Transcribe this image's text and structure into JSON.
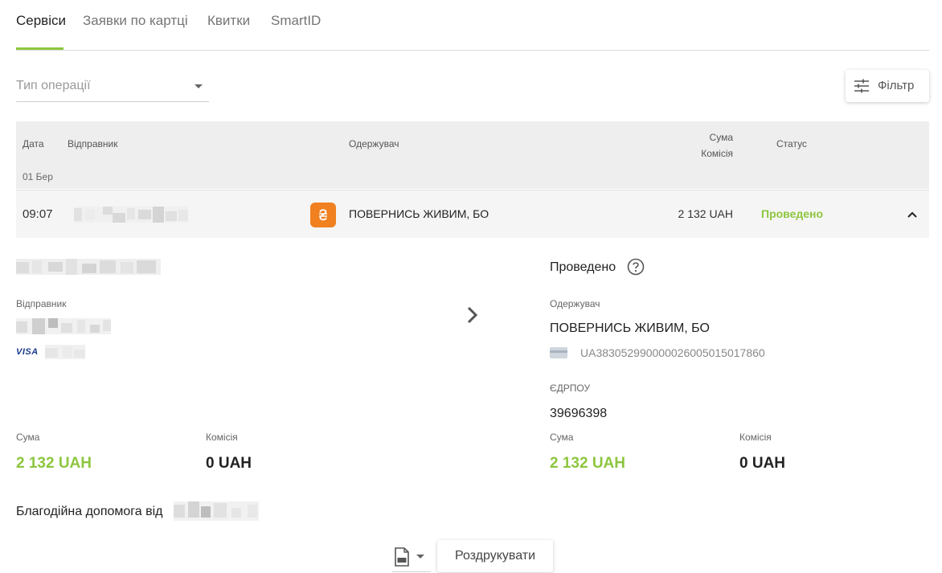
{
  "tabs": [
    {
      "label": "Сервіси",
      "active": true
    },
    {
      "label": "Заявки по картці",
      "active": false
    },
    {
      "label": "Квитки",
      "active": false
    },
    {
      "label": "SmartID",
      "active": false
    }
  ],
  "filters": {
    "operation_type_placeholder": "Тип операції",
    "filter_button": "Фільтр"
  },
  "table": {
    "headers": {
      "date": "Дата",
      "sender": "Відправник",
      "recipient": "Одержувач",
      "sum": "Сума",
      "commission": "Комісія",
      "status": "Статус"
    },
    "day_group": "01 Бер",
    "row": {
      "time": "09:07",
      "recipient": "ПОВЕРНИСЬ ЖИВИМ, БО",
      "sum": "2 132 UAH",
      "status": "Проведено"
    }
  },
  "detail": {
    "status": "Проведено",
    "sender_label": "Відправник",
    "card_brand": "VISA",
    "recipient_label": "Одержувач",
    "recipient_name": "ПОВЕРНИСЬ ЖИВИМ, БО",
    "iban": "UA383052990000026005015017860",
    "edrpou_label": "ЄДРПОУ",
    "edrpou": "39696398",
    "sender_sum_label": "Сума",
    "sender_sum": "2 132 UAH",
    "sender_commission_label": "Комісія",
    "sender_commission": "0 UAH",
    "recipient_sum_label": "Сума",
    "recipient_sum": "2 132 UAH",
    "recipient_commission_label": "Комісія",
    "recipient_commission": "0 UAH",
    "purpose": "Благодійна допомога від"
  },
  "actions": {
    "print_button": "Роздрукувати"
  },
  "colors": {
    "accent_green": "#8dc63f",
    "org_icon_orange": "#f08020"
  }
}
